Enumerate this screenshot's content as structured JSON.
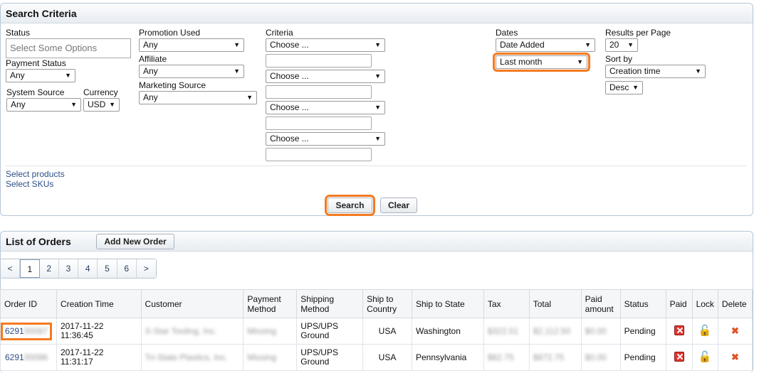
{
  "search": {
    "title": "Search Criteria",
    "status": {
      "label": "Status",
      "placeholder": "Select Some Options"
    },
    "payment_status": {
      "label": "Payment Status",
      "value": "Any"
    },
    "system_source": {
      "label": "System Source",
      "value": "Any"
    },
    "currency": {
      "label": "Currency",
      "value": "USD"
    },
    "promotion": {
      "label": "Promotion Used",
      "value": "Any"
    },
    "affiliate": {
      "label": "Affiliate",
      "value": "Any"
    },
    "marketing": {
      "label": "Marketing Source",
      "value": "Any"
    },
    "criteria": {
      "label": "Criteria",
      "selects": [
        "Choose ...",
        "Choose ...",
        "Choose ...",
        "Choose ..."
      ]
    },
    "dates": {
      "label": "Dates",
      "type": "Date Added",
      "range": "Last month"
    },
    "results_per_page": {
      "label": "Results per Page",
      "value": "20"
    },
    "sort_by": {
      "label": "Sort by",
      "value": "Creation time",
      "order": "Desc"
    },
    "links": {
      "products": "Select products",
      "skus": "Select SKUs"
    },
    "buttons": {
      "search": "Search",
      "clear": "Clear"
    },
    "arrow": "▼"
  },
  "orders": {
    "title": "List of Orders",
    "add_button": "Add New Order",
    "pager": {
      "prev": "<",
      "pages": [
        "1",
        "2",
        "3",
        "4",
        "5",
        "6"
      ],
      "next": ">"
    },
    "columns": [
      "Order ID",
      "Creation Time",
      "Customer",
      "Payment Method",
      "Shipping Method",
      "Ship to Country",
      "Ship to State",
      "Tax",
      "Total",
      "Paid amount",
      "Status",
      "Paid",
      "Lock",
      "Delete"
    ],
    "rows": [
      {
        "order_id": "6291",
        "order_id_hidden": "00087",
        "date": "2017-11-22",
        "time": "11:36:45",
        "customer": "X-Star Tooling, Inc.",
        "payment": "Missing",
        "ship1": "UPS/UPS",
        "ship2": "Ground",
        "country": "USA",
        "state": "Washington",
        "tax": "$322.51",
        "total": "$2,112.50",
        "paid": "$0.00",
        "status": "Pending"
      },
      {
        "order_id": "6291",
        "order_id_hidden": "00086",
        "date": "2017-11-22",
        "time": "11:31:17",
        "customer": "Tri-State Plastics, Inc.",
        "payment": "Missing",
        "ship1": "UPS/UPS",
        "ship2": "Ground",
        "country": "USA",
        "state": "Pennsylvania",
        "tax": "$62.75",
        "total": "$872.75",
        "paid": "$0.00",
        "status": "Pending"
      }
    ]
  },
  "colors": {
    "highlight": "#f47a20",
    "link": "#2d4f86",
    "border": "#b7c6d6"
  }
}
